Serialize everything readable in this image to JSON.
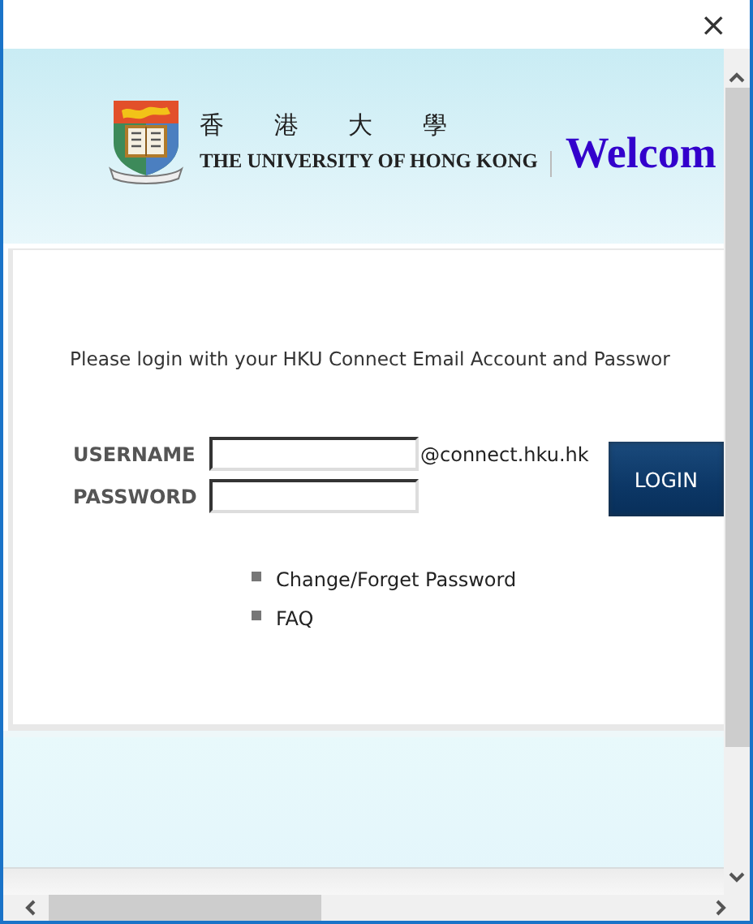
{
  "window": {
    "close": "×"
  },
  "header": {
    "chinese_name": "香 港 大 學",
    "english_name": "THE UNIVERSITY OF HONG KONG",
    "welcome": "Welcom"
  },
  "login": {
    "instruction": "Please login with your HKU Connect Email Account and Passwor",
    "username_label": "USERNAME",
    "domain_suffix": "@connect.hku.hk",
    "password_label": "PASSWORD",
    "login_button": "LOGIN"
  },
  "links": [
    {
      "label": "Change/Forget Password"
    },
    {
      "label": "FAQ"
    }
  ]
}
